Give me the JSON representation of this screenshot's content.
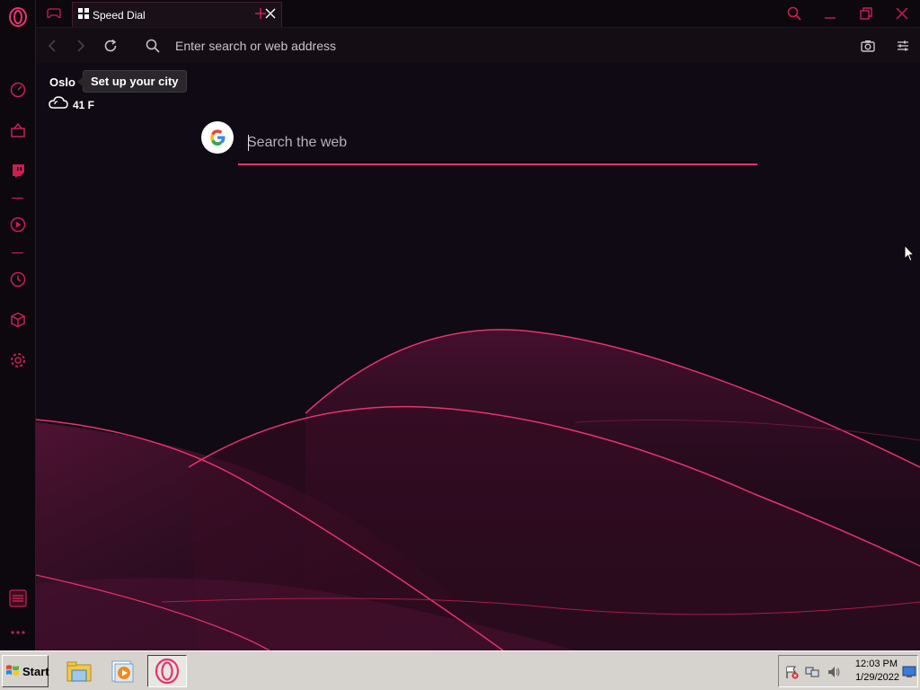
{
  "browser": {
    "tab_title": "Speed Dial",
    "address_placeholder": "Enter search or web address"
  },
  "weather": {
    "city": "Oslo",
    "tooltip": "Set up your city",
    "temperature": "41 F",
    "condition_icon": "cloud-icon"
  },
  "search": {
    "engine_icon": "google-logo-icon",
    "placeholder": "Search the web"
  },
  "sidebar": {
    "items": [
      {
        "name": "speed-dial-icon"
      },
      {
        "name": "ai-icon"
      },
      {
        "name": "twitch-icon"
      },
      {
        "name": "player-icon"
      },
      {
        "name": "history-icon"
      },
      {
        "name": "extensions-icon"
      },
      {
        "name": "settings-icon"
      },
      {
        "name": "gx-control-icon"
      },
      {
        "name": "more-icon"
      }
    ]
  },
  "taskbar": {
    "start_label": "Start",
    "clock_time": "12:03 PM",
    "clock_date": "1/29/2022",
    "apps": [
      "file-explorer-icon",
      "media-player-icon",
      "opera-gx-icon"
    ]
  },
  "colors": {
    "accent": "#e8336b",
    "background": "#100a14",
    "sidebar": "#0c080e"
  }
}
